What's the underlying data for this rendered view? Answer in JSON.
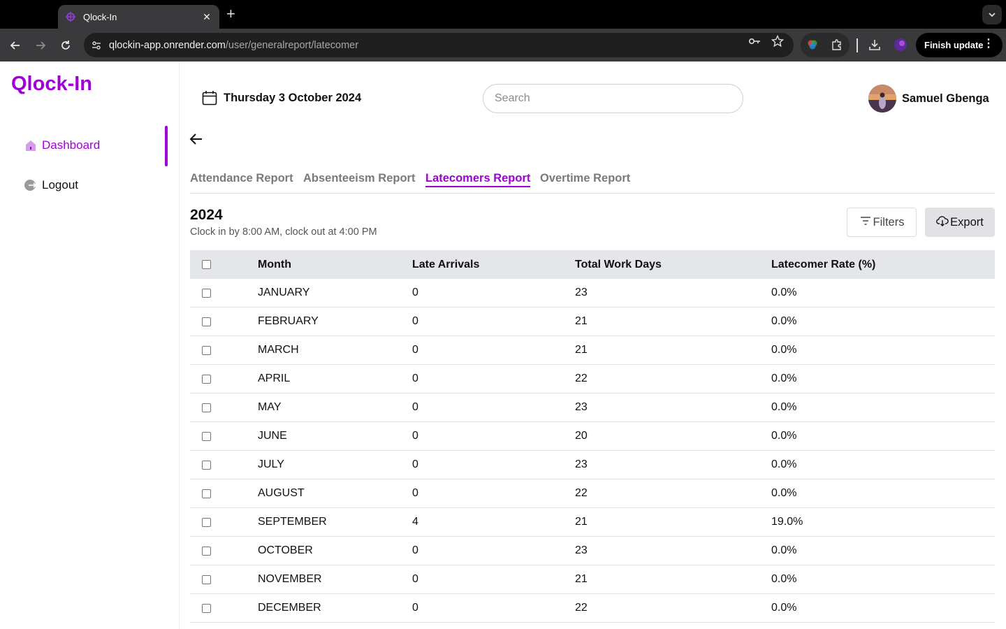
{
  "browser": {
    "tab_title": "Qlock-In",
    "url_host": "qlockin-app.onrender.com",
    "url_path": "/user/generalreport/latecomer",
    "finish_update_label": "Finish update"
  },
  "app": {
    "logo": "Qlock-In",
    "accent_color": "#a000d8"
  },
  "sidebar": {
    "items": [
      {
        "label": "Dashboard",
        "icon": "home-icon",
        "active": true
      },
      {
        "label": "Logout",
        "icon": "logout-icon",
        "active": false
      }
    ]
  },
  "header": {
    "date": "Thursday 3 October 2024",
    "search_placeholder": "Search",
    "user_name": "Samuel Gbenga"
  },
  "report_tabs": [
    {
      "label": "Attendance Report",
      "active": false
    },
    {
      "label": "Absenteeism Report",
      "active": false
    },
    {
      "label": "Latecomers Report",
      "active": true
    },
    {
      "label": "Overtime Report",
      "active": false
    }
  ],
  "report": {
    "year": "2024",
    "subtitle": "Clock in by 8:00 AM, clock out at 4:00 PM",
    "filters_label": "Filters",
    "export_label": "Export"
  },
  "table": {
    "columns": [
      "Month",
      "Late Arrivals",
      "Total Work Days",
      "Latecomer Rate (%)"
    ],
    "rows": [
      {
        "month": "JANUARY",
        "late": "0",
        "total": "23",
        "rate": "0.0%"
      },
      {
        "month": "FEBRUARY",
        "late": "0",
        "total": "21",
        "rate": "0.0%"
      },
      {
        "month": "MARCH",
        "late": "0",
        "total": "21",
        "rate": "0.0%"
      },
      {
        "month": "APRIL",
        "late": "0",
        "total": "22",
        "rate": "0.0%"
      },
      {
        "month": "MAY",
        "late": "0",
        "total": "23",
        "rate": "0.0%"
      },
      {
        "month": "JUNE",
        "late": "0",
        "total": "20",
        "rate": "0.0%"
      },
      {
        "month": "JULY",
        "late": "0",
        "total": "23",
        "rate": "0.0%"
      },
      {
        "month": "AUGUST",
        "late": "0",
        "total": "22",
        "rate": "0.0%"
      },
      {
        "month": "SEPTEMBER",
        "late": "4",
        "total": "21",
        "rate": "19.0%"
      },
      {
        "month": "OCTOBER",
        "late": "0",
        "total": "23",
        "rate": "0.0%"
      },
      {
        "month": "NOVEMBER",
        "late": "0",
        "total": "21",
        "rate": "0.0%"
      },
      {
        "month": "DECEMBER",
        "late": "0",
        "total": "22",
        "rate": "0.0%"
      }
    ]
  }
}
